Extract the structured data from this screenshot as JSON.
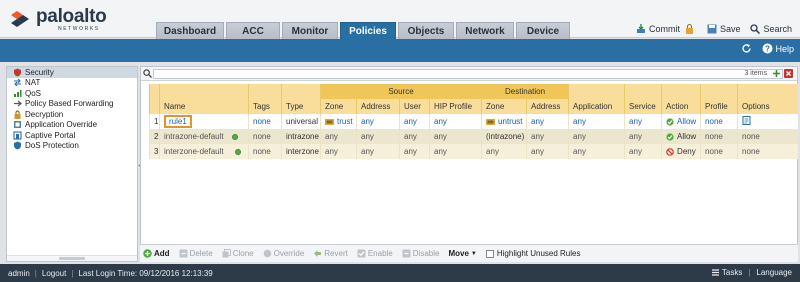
{
  "brand": {
    "name": "paloalto",
    "sub": "NETWORKS"
  },
  "tabs": [
    "Dashboard",
    "ACC",
    "Monitor",
    "Policies",
    "Objects",
    "Network",
    "Device"
  ],
  "active_tab": "Policies",
  "top_actions": {
    "commit": "Commit",
    "save": "Save",
    "search": "Search"
  },
  "bluebar": {
    "help": "Help"
  },
  "sidebar": {
    "items": [
      {
        "label": "Security",
        "icon": "shield-icon",
        "active": true
      },
      {
        "label": "NAT",
        "icon": "nat-icon"
      },
      {
        "label": "QoS",
        "icon": "qos-icon"
      },
      {
        "label": "Policy Based Forwarding",
        "icon": "forwarding-icon"
      },
      {
        "label": "Decryption",
        "icon": "lock-icon"
      },
      {
        "label": "Application Override",
        "icon": "override-icon"
      },
      {
        "label": "Captive Portal",
        "icon": "portal-icon"
      },
      {
        "label": "DoS Protection",
        "icon": "dos-icon"
      }
    ]
  },
  "search": {
    "placeholder": "",
    "items": "3 items"
  },
  "table": {
    "groups": {
      "source": "Source",
      "destination": "Destination"
    },
    "headers": [
      "Name",
      "Tags",
      "Type",
      "Zone",
      "Address",
      "User",
      "HIP Profile",
      "Zone",
      "Address",
      "Application",
      "Service",
      "Action",
      "Profile",
      "Options"
    ],
    "rows": [
      {
        "num": "1",
        "name": "rule1",
        "tags": "none",
        "type": "universal",
        "src_zone": "trust",
        "src_addr": "any",
        "user": "any",
        "hip": "any",
        "dst_zone": "untrust",
        "dst_addr": "any",
        "app": "any",
        "service": "any",
        "action": "Allow",
        "profile": "none",
        "options": ""
      },
      {
        "num": "2",
        "name": "intrazone-default",
        "tags": "none",
        "type": "intrazone",
        "src_zone": "any",
        "src_addr": "any",
        "user": "any",
        "hip": "any",
        "dst_zone": "(intrazone)",
        "dst_addr": "any",
        "app": "any",
        "service": "any",
        "action": "Allow",
        "profile": "none",
        "options": "none"
      },
      {
        "num": "3",
        "name": "interzone-default",
        "tags": "none",
        "type": "interzone",
        "src_zone": "any",
        "src_addr": "any",
        "user": "any",
        "hip": "any",
        "dst_zone": "any",
        "dst_addr": "any",
        "app": "any",
        "service": "any",
        "action": "Deny",
        "profile": "none",
        "options": "none"
      }
    ]
  },
  "actionbar": {
    "add": "Add",
    "delete": "Delete",
    "clone": "Clone",
    "override": "Override",
    "revert": "Revert",
    "enable": "Enable",
    "disable": "Disable",
    "move": "Move",
    "highlight": "Highlight Unused Rules"
  },
  "status": {
    "user": "admin",
    "logout": "Logout",
    "last_login": "Last Login Time: 09/12/2016 12:13:39",
    "tasks": "Tasks",
    "language": "Language"
  },
  "colors": {
    "accent": "#2a6fa3",
    "header": "#f8de9a",
    "group_header": "#f0c659",
    "highlight": "#e8922d"
  }
}
